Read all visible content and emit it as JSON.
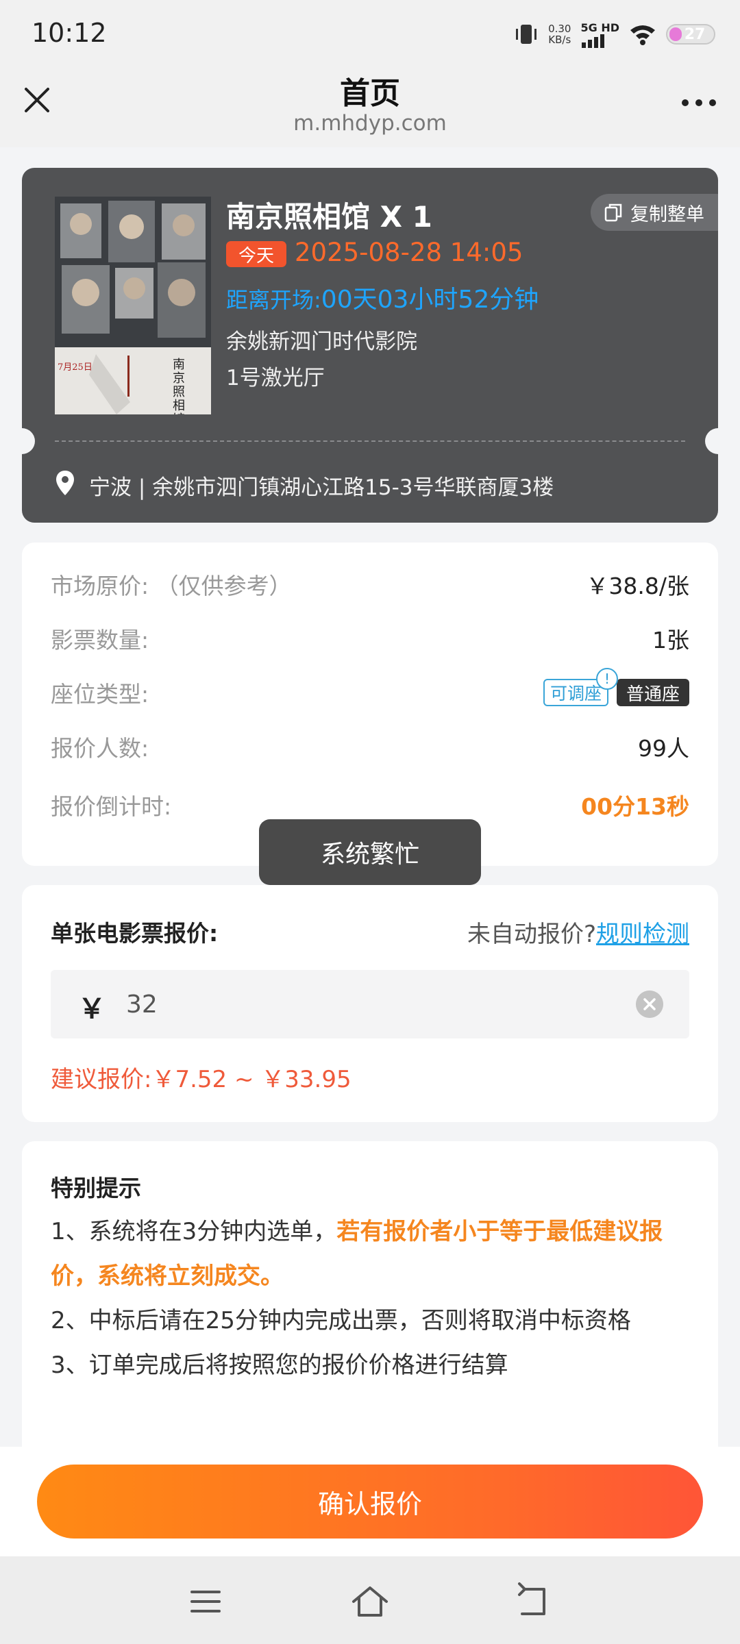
{
  "status_bar": {
    "time": "10:12",
    "speed_value": "0.30",
    "speed_unit": "KB/s",
    "network": "5G HD",
    "battery": "27"
  },
  "header": {
    "title": "首页",
    "url": "m.mhdyp.com"
  },
  "ticket": {
    "movie_title": "南京照相馆  X 1",
    "copy_label": "复制整单",
    "today_badge": "今天",
    "show_time": "2025-08-28 14:05",
    "countdown_label": "距离开场:",
    "countdown_value": "00天03小时52分钟",
    "cinema": "余姚新泗门时代影院",
    "hall": "1号激光厅",
    "address": "宁波 | 余姚市泗门镇湖心江路15-3号华联商厦3楼",
    "poster_text": "南京照相馆",
    "poster_date": "7月25日"
  },
  "info": {
    "market_price_label": "市场原价: （仅供参考）",
    "market_price_value": "￥38.8/张",
    "quantity_label": "影票数量:",
    "quantity_value": "1张",
    "seat_type_label": "座位类型:",
    "seat_tag_adjustable": "可调座",
    "seat_tag_normal": "普通座",
    "bidders_label": "报价人数:",
    "bidders_value": "99人",
    "bid_countdown_label": "报价倒计时:",
    "bid_countdown_value": "00分13秒"
  },
  "toast": "系统繁忙",
  "bid": {
    "title": "单张电影票报价:",
    "hint_text": "未自动报价?",
    "hint_link": "规则检测",
    "currency": "￥",
    "input_value": "32",
    "suggest": "建议报价:￥7.52 ~ ￥33.95"
  },
  "notice": {
    "title": "特别提示",
    "item1_prefix": "1、系统将在3分钟内选单，",
    "item1_highlight": "若有报价者小于等于最低建议报价，系统将立刻成交。",
    "item2": "2、中标后请在25分钟内完成出票，否则将取消中标资格",
    "item3": "3、订单完成后将按照您的报价价格进行结算"
  },
  "action": {
    "confirm": "确认报价"
  },
  "colors": {
    "accent_orange": "#ff6a2b",
    "link_blue": "#1ea0e6",
    "card_dark": "#515254"
  }
}
